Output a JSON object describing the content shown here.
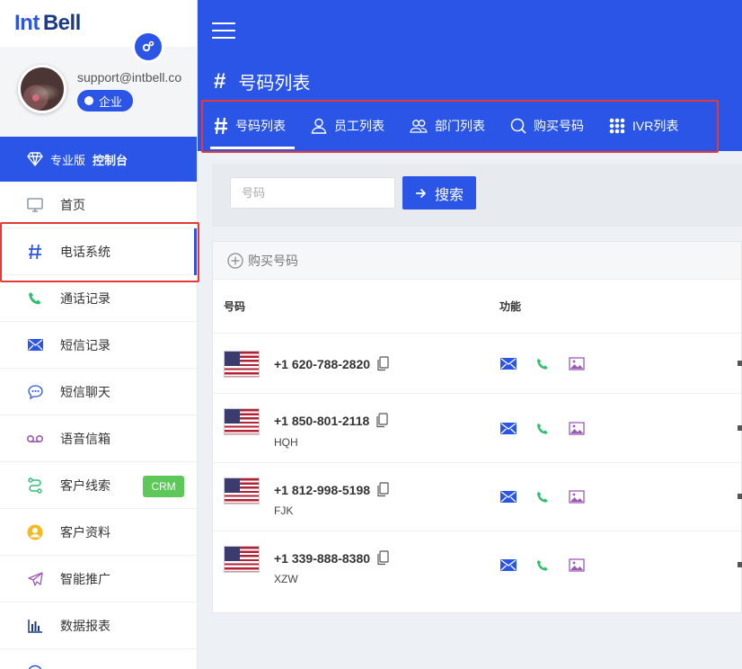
{
  "brand": {
    "int": "Int",
    "bell": "Bell"
  },
  "user": {
    "email": "support@intbell.com",
    "plan": "企业"
  },
  "console": {
    "prefix": "专业版",
    "bold": "控制台"
  },
  "nav": [
    {
      "label": "首页",
      "icon": "monitor-icon"
    },
    {
      "label": "电话系统",
      "icon": "hash-icon",
      "active": true
    },
    {
      "label": "通话记录",
      "icon": "phone-icon"
    },
    {
      "label": "短信记录",
      "icon": "envelope-icon"
    },
    {
      "label": "短信聊天",
      "icon": "chat-icon"
    },
    {
      "label": "语音信箱",
      "icon": "voicemail-icon"
    },
    {
      "label": "客户线索",
      "icon": "route-icon",
      "tag": "CRM"
    },
    {
      "label": "客户资料",
      "icon": "user-circle-icon"
    },
    {
      "label": "智能推广",
      "icon": "paper-plane-icon"
    },
    {
      "label": "数据报表",
      "icon": "bar-chart-icon"
    }
  ],
  "header": {
    "title": "号码列表"
  },
  "tabs": [
    {
      "label": "号码列表",
      "icon": "hash-icon",
      "active": true
    },
    {
      "label": "员工列表",
      "icon": "user-icon"
    },
    {
      "label": "部门列表",
      "icon": "users-icon"
    },
    {
      "label": "购买号码",
      "icon": "search-icon"
    },
    {
      "label": "IVR列表",
      "icon": "grid-icon"
    }
  ],
  "search": {
    "placeholder": "号码",
    "button": "搜索"
  },
  "table": {
    "buy_label": "购买号码",
    "headers": [
      "号码",
      "功能"
    ],
    "rows": [
      {
        "number": "+1 620-788-2820",
        "label": ""
      },
      {
        "number": "+1 850-801-2118",
        "label": "HQH"
      },
      {
        "number": "+1 812-998-5198",
        "label": "FJK"
      },
      {
        "number": "+1 339-888-8380",
        "label": "XZW"
      }
    ]
  },
  "colors": {
    "primary": "#2b55e6",
    "highlight": "#e53935",
    "crm": "#5cc85a"
  }
}
